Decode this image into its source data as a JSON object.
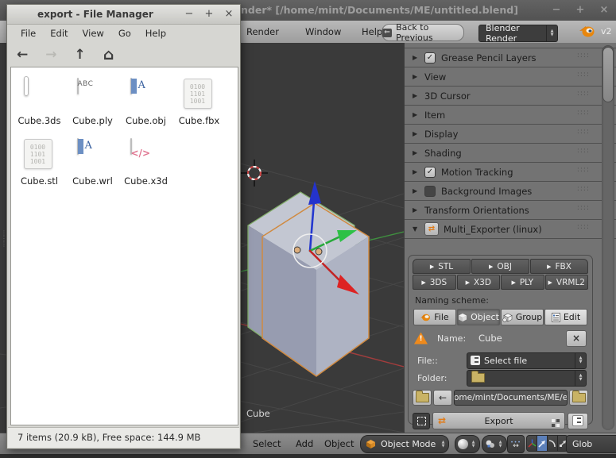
{
  "colors": {
    "blender_orange": "#e8860c",
    "selection_blue": "#5b7fb9",
    "warning_orange": "#ef8a1c",
    "axis_red": "#a33c3c",
    "axis_green": "#3f8f3f"
  },
  "icons": {
    "minimize": "−",
    "maximize": "+",
    "close": "×",
    "back": "←",
    "forward": "→",
    "up": "↑",
    "home": "⌂",
    "expand": "▶",
    "collapse": "▼",
    "check": "✓",
    "stepper_up": "▲",
    "stepper_down": "▼",
    "play": "▶",
    "swap": "⇄",
    "clear": "×",
    "back_boxed": "⇐",
    "warning": "!",
    "snap_arrows": "↔",
    "grip": "::::",
    "edge_grip": "⋮"
  },
  "file_manager": {
    "title": "export - File Manager",
    "menu": {
      "file": "File",
      "edit": "Edit",
      "view": "View",
      "go": "Go",
      "help": "Help"
    },
    "files": [
      {
        "name": "Cube.3ds",
        "icon": "image"
      },
      {
        "name": "Cube.ply",
        "icon": "text-abc"
      },
      {
        "name": "Cube.obj",
        "icon": "doc-a"
      },
      {
        "name": "Cube.fbx",
        "icon": "binary"
      },
      {
        "name": "Cube.stl",
        "icon": "binary"
      },
      {
        "name": "Cube.wrl",
        "icon": "doc-a"
      },
      {
        "name": "Cube.x3d",
        "icon": "markup"
      }
    ],
    "icon_text": {
      "abc": "ABC",
      "binary_lines": [
        "0100",
        "1101",
        "1001"
      ],
      "markup": "</>"
    },
    "statusbar": "7 items (20.9 kB), Free space: 144.9 MB"
  },
  "blender": {
    "title": "nder* [/home/mint/Documents/ME/untitled.blend]",
    "menubar": {
      "render": "Render",
      "window": "Window",
      "help": "Help",
      "back_button": "Back to Previous",
      "engine": "Blender Render",
      "version": "v2"
    },
    "panels": [
      {
        "label": "Grease Pencil Layers",
        "checkbox": "checked"
      },
      {
        "label": "View"
      },
      {
        "label": "3D Cursor"
      },
      {
        "label": "Item"
      },
      {
        "label": "Display"
      },
      {
        "label": "Shading"
      },
      {
        "label": "Motion Tracking",
        "checkbox": "checked"
      },
      {
        "label": "Background Images",
        "checkbox": "unchecked"
      },
      {
        "label": "Transform Orientations"
      },
      {
        "label": "Multi_Exporter (linux)",
        "expanded": true
      }
    ],
    "exporter": {
      "formats_row1": [
        "STL",
        "OBJ",
        "FBX"
      ],
      "formats_row2": [
        "3DS",
        "X3D",
        "PLY",
        "VRML2"
      ],
      "naming_scheme_label": "Naming scheme:",
      "naming_buttons": [
        "File",
        "Object",
        "Group",
        "Edit"
      ],
      "name_label": "Name:",
      "name_value": "Cube",
      "file_label": "File::",
      "file_select": "Select file",
      "folder_label": "Folder:",
      "path": "/home/mint/Documents/ME/e...",
      "export_label": "Export"
    },
    "viewport": {
      "object_label": "Cube"
    },
    "footer": {
      "select": "Select",
      "add": "Add",
      "object": "Object",
      "mode": "Object Mode",
      "orientation": "Glob"
    }
  }
}
